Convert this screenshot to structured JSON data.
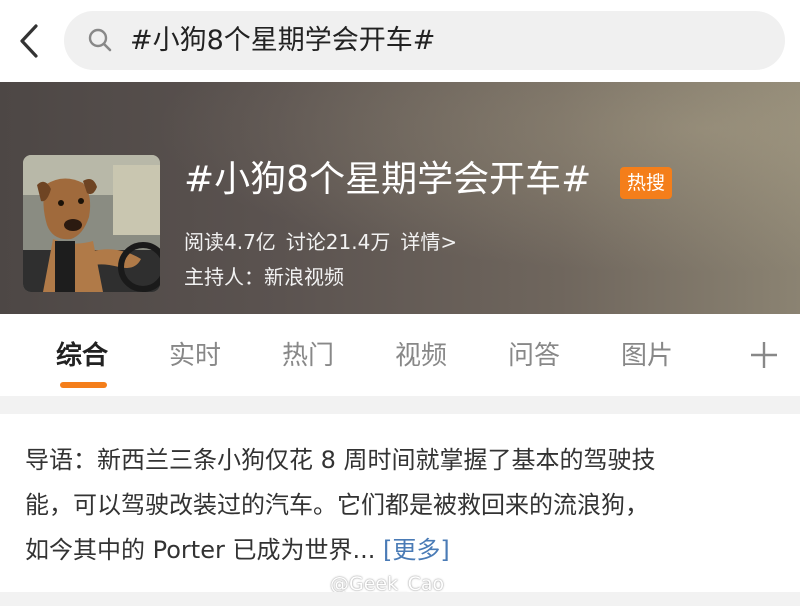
{
  "search": {
    "query": "#小狗8个星期学会开车#"
  },
  "topic": {
    "title": "#小狗8个星期学会开车#",
    "badge": "热搜",
    "reads": "阅读4.7亿",
    "discussions": "讨论21.4万",
    "details_link": "详情>",
    "host": "主持人：新浪视频"
  },
  "tabs": [
    {
      "label": "综合",
      "active": true
    },
    {
      "label": "实时",
      "active": false
    },
    {
      "label": "热门",
      "active": false
    },
    {
      "label": "视频",
      "active": false
    },
    {
      "label": "问答",
      "active": false
    },
    {
      "label": "图片",
      "active": false
    }
  ],
  "intro": {
    "line1": "导语：新西兰三条小狗仅花 8 周时间就掌握了基本的驾驶技",
    "line2": "能，可以驾驶改装过的汽车。它们都是被救回来的流浪狗，",
    "line3": "如今其中的 Porter 已成为世界...",
    "more_link": "[更多]"
  },
  "watermark": "@Geek_Cao",
  "colors": {
    "accent": "#f47e1a",
    "link": "#4a7bb6",
    "badge": "#f47e1a"
  },
  "icons": {
    "back": "chevron-left-icon",
    "search": "search-icon",
    "add_tab": "plus-icon"
  }
}
